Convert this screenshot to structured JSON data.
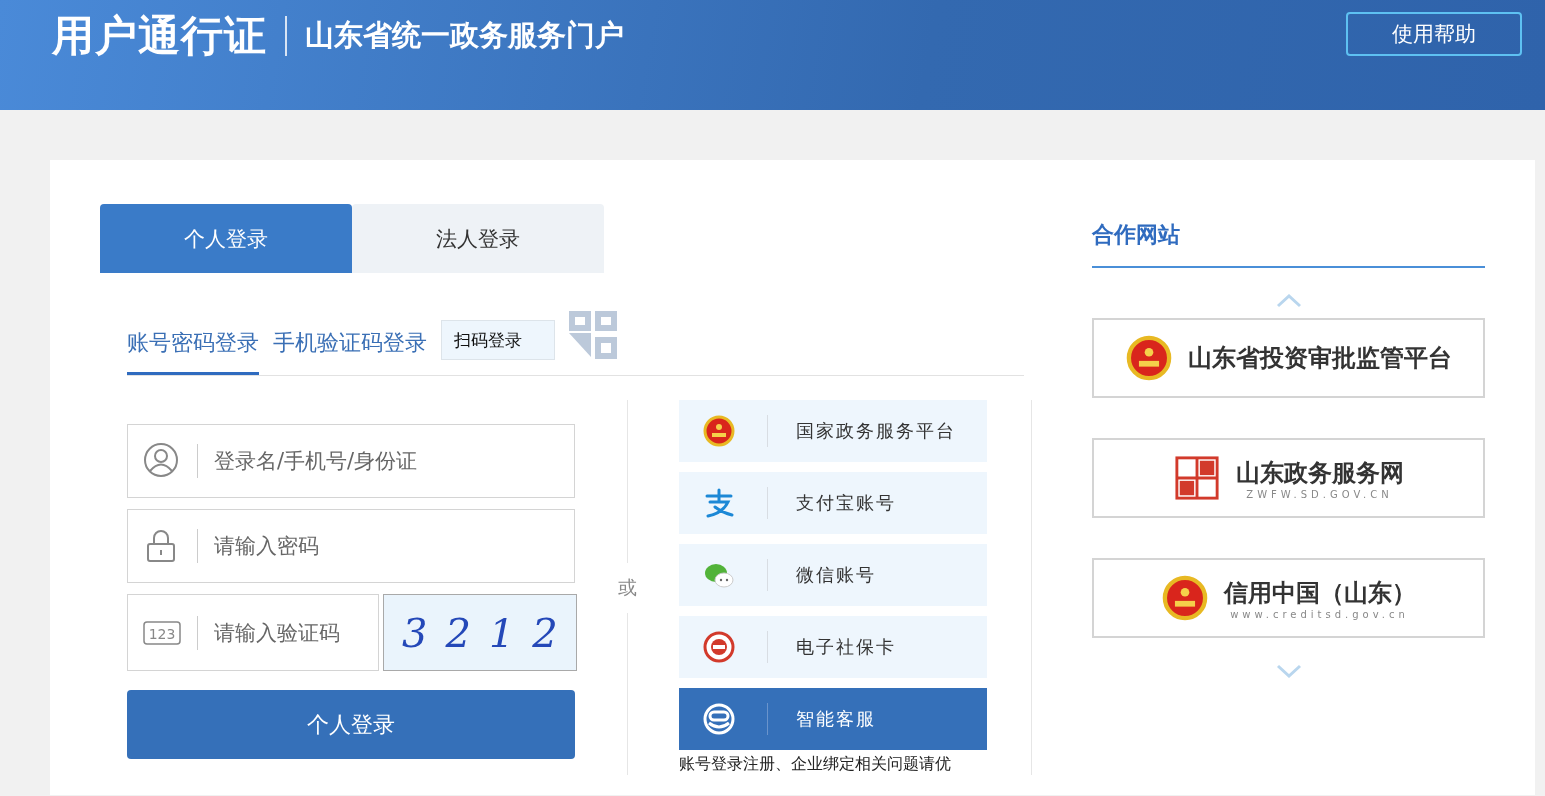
{
  "header": {
    "title": "用户通行证",
    "subtitle": "山东省统一政务服务门户",
    "help_button": "使用帮助"
  },
  "login_tabs": [
    {
      "label": "个人登录",
      "selected": true
    },
    {
      "label": "法人登录",
      "selected": false
    }
  ],
  "login_methods": [
    {
      "label": "账号密码登录",
      "selected": true
    },
    {
      "label": "手机验证码登录",
      "selected": false
    }
  ],
  "qr_login": {
    "label": "扫码登录"
  },
  "form": {
    "fields": [
      {
        "kind": "user",
        "placeholder": "登录名/手机号/身份证"
      },
      {
        "kind": "lock",
        "placeholder": "请输入密码"
      },
      {
        "kind": "code",
        "placeholder": "请输入验证码",
        "icon_text": "123"
      }
    ],
    "captcha": "3212",
    "submit": "个人登录"
  },
  "divider_text": "或",
  "other_logins": [
    {
      "kind": "emblem",
      "label": "国家政务服务平台",
      "selected": false
    },
    {
      "kind": "alipay",
      "label": "支付宝账号",
      "selected": false
    },
    {
      "kind": "wechat",
      "label": "微信账号",
      "selected": false
    },
    {
      "kind": "social",
      "label": "电子社保卡",
      "selected": false
    },
    {
      "kind": "robot",
      "label": "智能客服",
      "selected": true
    }
  ],
  "help_note": "账号登录注册、企业绑定相关问题请优",
  "partners": {
    "title": "合作网站",
    "sites": [
      {
        "kind": "emblem",
        "name": "山东省投资审批监管平台"
      },
      {
        "kind": "seal",
        "name": "山东政务服务网",
        "url": "ZWFW.SD.GOV.CN"
      },
      {
        "kind": "emblem",
        "name": "信用中国（山东）",
        "url": "www.creditsd.gov.cn"
      }
    ]
  }
}
